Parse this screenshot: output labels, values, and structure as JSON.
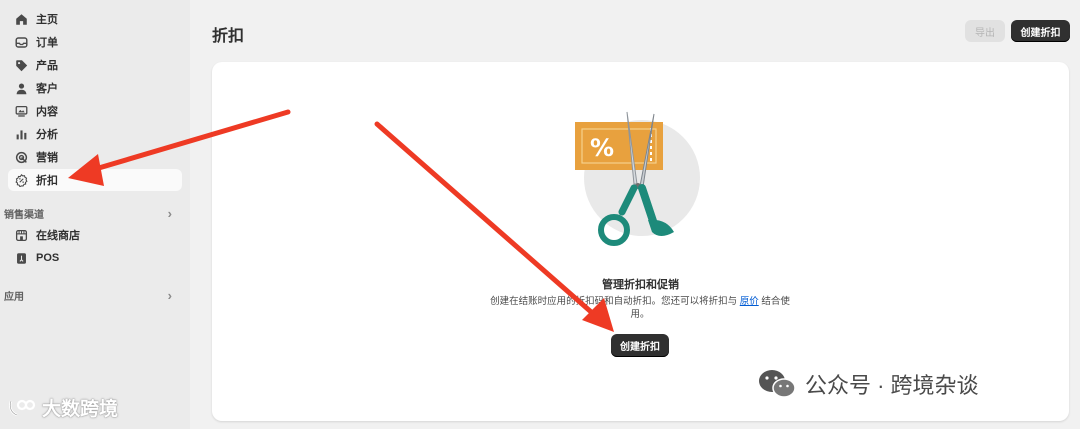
{
  "sidebar": {
    "items": [
      {
        "label": "主页",
        "icon": "home-icon"
      },
      {
        "label": "订单",
        "icon": "inbox-icon"
      },
      {
        "label": "产品",
        "icon": "tag-icon"
      },
      {
        "label": "客户",
        "icon": "person-icon"
      },
      {
        "label": "内容",
        "icon": "content-icon"
      },
      {
        "label": "分析",
        "icon": "bar-chart-icon"
      },
      {
        "label": "营销",
        "icon": "target-icon"
      },
      {
        "label": "折扣",
        "icon": "discount-icon",
        "active": true
      }
    ],
    "sales_channels": {
      "heading": "销售渠道",
      "items": [
        {
          "label": "在线商店",
          "icon": "store-icon"
        },
        {
          "label": "POS",
          "icon": "pos-icon"
        }
      ]
    },
    "apps": {
      "heading": "应用"
    }
  },
  "header": {
    "title": "折扣",
    "export_label": "导出",
    "create_label": "创建折扣"
  },
  "empty_state": {
    "heading": "管理折扣和促销",
    "desc_before": "创建在结账时应用的折扣码和自动折扣。您还可以将折扣与",
    "desc_link": "原价",
    "desc_after": "结合使用。",
    "button_label": "创建折扣"
  },
  "watermarks": {
    "left": "大数跨境",
    "right": "公众号 · 跨境杂谈"
  },
  "colors": {
    "annotation_arrow": "#ee3a24",
    "primary_button": "#303030",
    "link": "#005bd3"
  }
}
